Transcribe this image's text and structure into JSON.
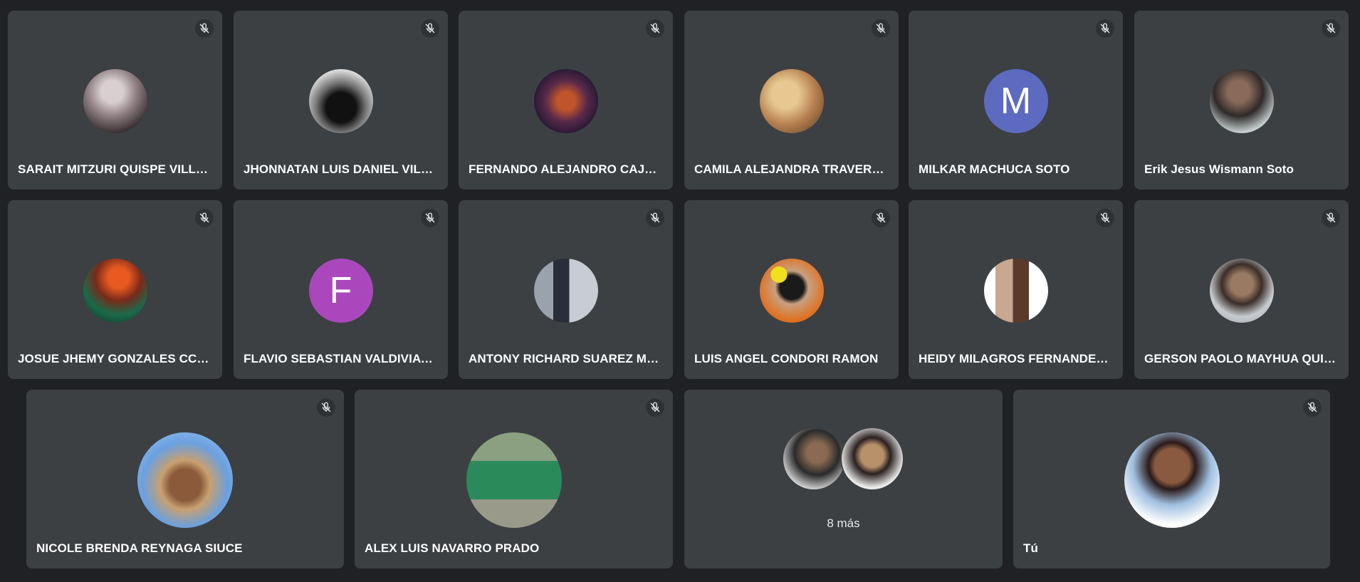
{
  "participants": [
    {
      "name": "SARAIT MITZURI QUISPE VILLAL...",
      "avatar": "photo-person-selfie",
      "muted": true
    },
    {
      "name": "JHONNATAN LUIS DANIEL VILC...",
      "avatar": "photo-drum-kit",
      "muted": true
    },
    {
      "name": "FERNANDO ALEJANDRO CAJAH...",
      "avatar": "photo-fantasy-creature",
      "muted": true
    },
    {
      "name": "CAMILA ALEJANDRA TRAVERSO...",
      "avatar": "photo-cartoon-face",
      "muted": true
    },
    {
      "name": "MILKAR MACHUCA SOTO",
      "avatar": "letter",
      "initial": "M",
      "muted": true
    },
    {
      "name": "Erik Jesus Wismann Soto",
      "avatar": "photo-person-sunglasses",
      "muted": true
    },
    {
      "name": "JOSUE JHEMY GONZALES CCE...",
      "avatar": "photo-anime-character",
      "muted": true
    },
    {
      "name": "FLAVIO SEBASTIAN VALDIVIA ES...",
      "avatar": "letter",
      "initial": "F",
      "muted": true
    },
    {
      "name": "ANTONY RICHARD SUAREZ MA...",
      "avatar": "photo-person-window",
      "muted": true
    },
    {
      "name": "LUIS ANGEL CONDORI RAMON",
      "avatar": "photo-person-mask",
      "muted": true
    },
    {
      "name": "HEIDY MILAGROS FERNANDEZ ...",
      "avatar": "photo-person-hat",
      "muted": true
    },
    {
      "name": "GERSON PAOLO MAYHUA QUIS...",
      "avatar": "photo-person-portrait",
      "muted": true
    },
    {
      "name": "NICOLE BRENDA REYNAGA SIUCE",
      "avatar": "photo-person-straw-hat",
      "muted": true
    },
    {
      "name": "ALEX LUIS NAVARRO PRADO",
      "avatar": "photo-person-garden",
      "muted": true
    }
  ],
  "more_tile": {
    "label": "8 más"
  },
  "self_tile": {
    "name": "Tú",
    "avatar": "photo-man-portrait",
    "muted": true
  },
  "colors": {
    "background": "#202124",
    "tile": "#3c4043",
    "avatar_m": "#5c6bc0",
    "avatar_f": "#ab47bc"
  }
}
